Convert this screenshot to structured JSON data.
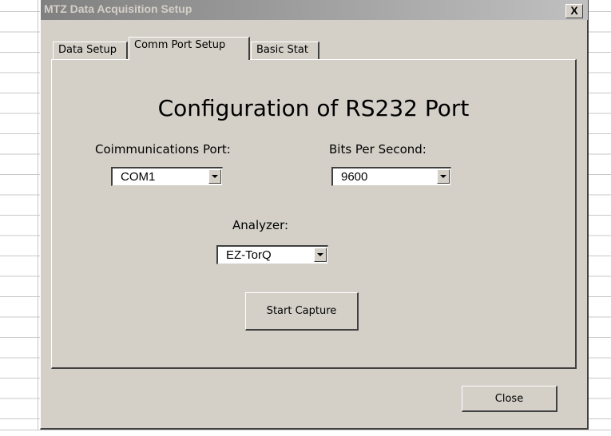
{
  "dialog": {
    "title": "MTZ Data Acquisition Setup",
    "close_glyph": "X"
  },
  "tabs": [
    {
      "label": "Data Setup",
      "active": false
    },
    {
      "label": "Comm Port Setup",
      "active": true
    },
    {
      "label": "Basic Stat",
      "active": false
    }
  ],
  "panel": {
    "heading": "Configuration of RS232 Port",
    "comm_port": {
      "label": "Coimmunications Port:",
      "value": "COM1"
    },
    "bits_per_second": {
      "label": "Bits Per Second:",
      "value": "9600"
    },
    "analyzer": {
      "label": "Analyzer:",
      "value": "EZ-TorQ"
    },
    "start_button": "Start Capture"
  },
  "footer": {
    "close_button": "Close"
  },
  "icons": {
    "dropdown": "chevron-down-icon",
    "close": "close-icon"
  }
}
